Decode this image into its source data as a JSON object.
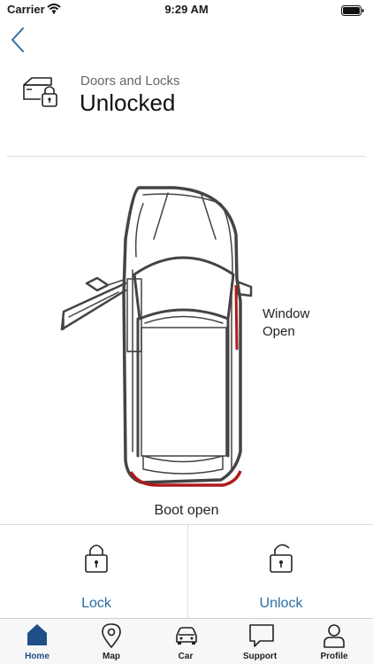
{
  "status_bar": {
    "carrier": "Carrier",
    "time": "9:29 AM"
  },
  "header": {
    "subtitle": "Doors and Locks",
    "title": "Unlocked"
  },
  "vehicle_status": {
    "window_label_line1": "Window",
    "window_label_line2": "Open",
    "boot_label": "Boot open"
  },
  "actions": {
    "lock_label": "Lock",
    "unlock_label": "Unlock"
  },
  "tabs": [
    {
      "label": "Home",
      "icon": "home-icon",
      "active": true
    },
    {
      "label": "Map",
      "icon": "map-pin-icon",
      "active": false
    },
    {
      "label": "Car",
      "icon": "car-icon",
      "active": false
    },
    {
      "label": "Support",
      "icon": "chat-icon",
      "active": false
    },
    {
      "label": "Profile",
      "icon": "profile-icon",
      "active": false
    }
  ],
  "colors": {
    "accent": "#2d6ea3",
    "tab_active": "#1f4f86",
    "alert": "#b01a1a"
  }
}
